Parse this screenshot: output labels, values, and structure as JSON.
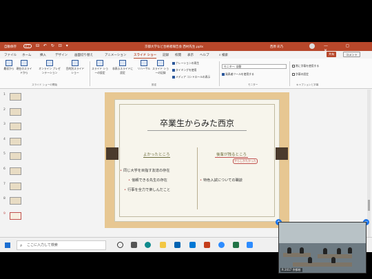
{
  "titlebar": {
    "autosave_label": "自動保存",
    "autosave_state": "オフ",
    "quick_access": "⊟ ↶ ↻ ⊡ ▾",
    "doc_title": "京都大学など合格者報告会 西村先生.pptx",
    "user": "西原 彩乃",
    "window_buttons": "— ◻ ✕"
  },
  "tabs": [
    "ファイル",
    "ホーム",
    "挿入",
    "デザイン",
    "画面切り替え",
    "アニメーション",
    "スライド ショー",
    "記録",
    "校閲",
    "表示",
    "ヘルプ"
  ],
  "active_tab": "スライド ショー",
  "search_label": "検索",
  "share_label": "共有",
  "comment_label": "コメント",
  "ribbon": {
    "start_buttons": [
      "最初から",
      "現在のスライドから",
      "オンライン プレゼンテーション",
      "目的別スライド ショー"
    ],
    "setup_buttons": [
      "スライド ショーの設定",
      "非表示スライドに設定",
      "リハーサル",
      "スライド ショーの記録"
    ],
    "checkboxes": [
      "ナレーションの再生",
      "タイミングを使用",
      "メディア コントロールの表示"
    ],
    "monitor_label": "モニター:",
    "monitor_value": "自動",
    "presenter_view": "発表者ツールを使用する",
    "captions": [
      "常に字幕を使用する",
      "字幕の設定"
    ],
    "group_names": [
      "スライド ショーの開始",
      "設定",
      "モニター",
      "キャプションと字幕"
    ]
  },
  "thumbnails": [
    "1",
    "2",
    "3",
    "4",
    "5",
    "6",
    "7",
    "8",
    "9"
  ],
  "selected_slide": "9",
  "slide": {
    "title": "卒業生からみた西京",
    "left_heading": "よかったところ",
    "right_heading": "後輩が残るところ",
    "annotation": "やらしかたかった",
    "left_bullets": [
      "同じ大学を目指す友達の存在",
      "信頼できる先生の存在",
      "行事を全力で楽しんだこと"
    ],
    "right_bullets": [
      "特色入試についての職談"
    ]
  },
  "status": {
    "slide_count": "スライド 9/9",
    "language": "日本語",
    "notes": "ノート"
  },
  "taskbar": {
    "search_placeholder": "ここに入力して検索"
  },
  "zoom": {
    "participant_name": "R 2017 京都校"
  },
  "colors": {
    "accent": "#b7472a",
    "slide_bg": "#e7c792",
    "bullet": "#c0504d"
  }
}
